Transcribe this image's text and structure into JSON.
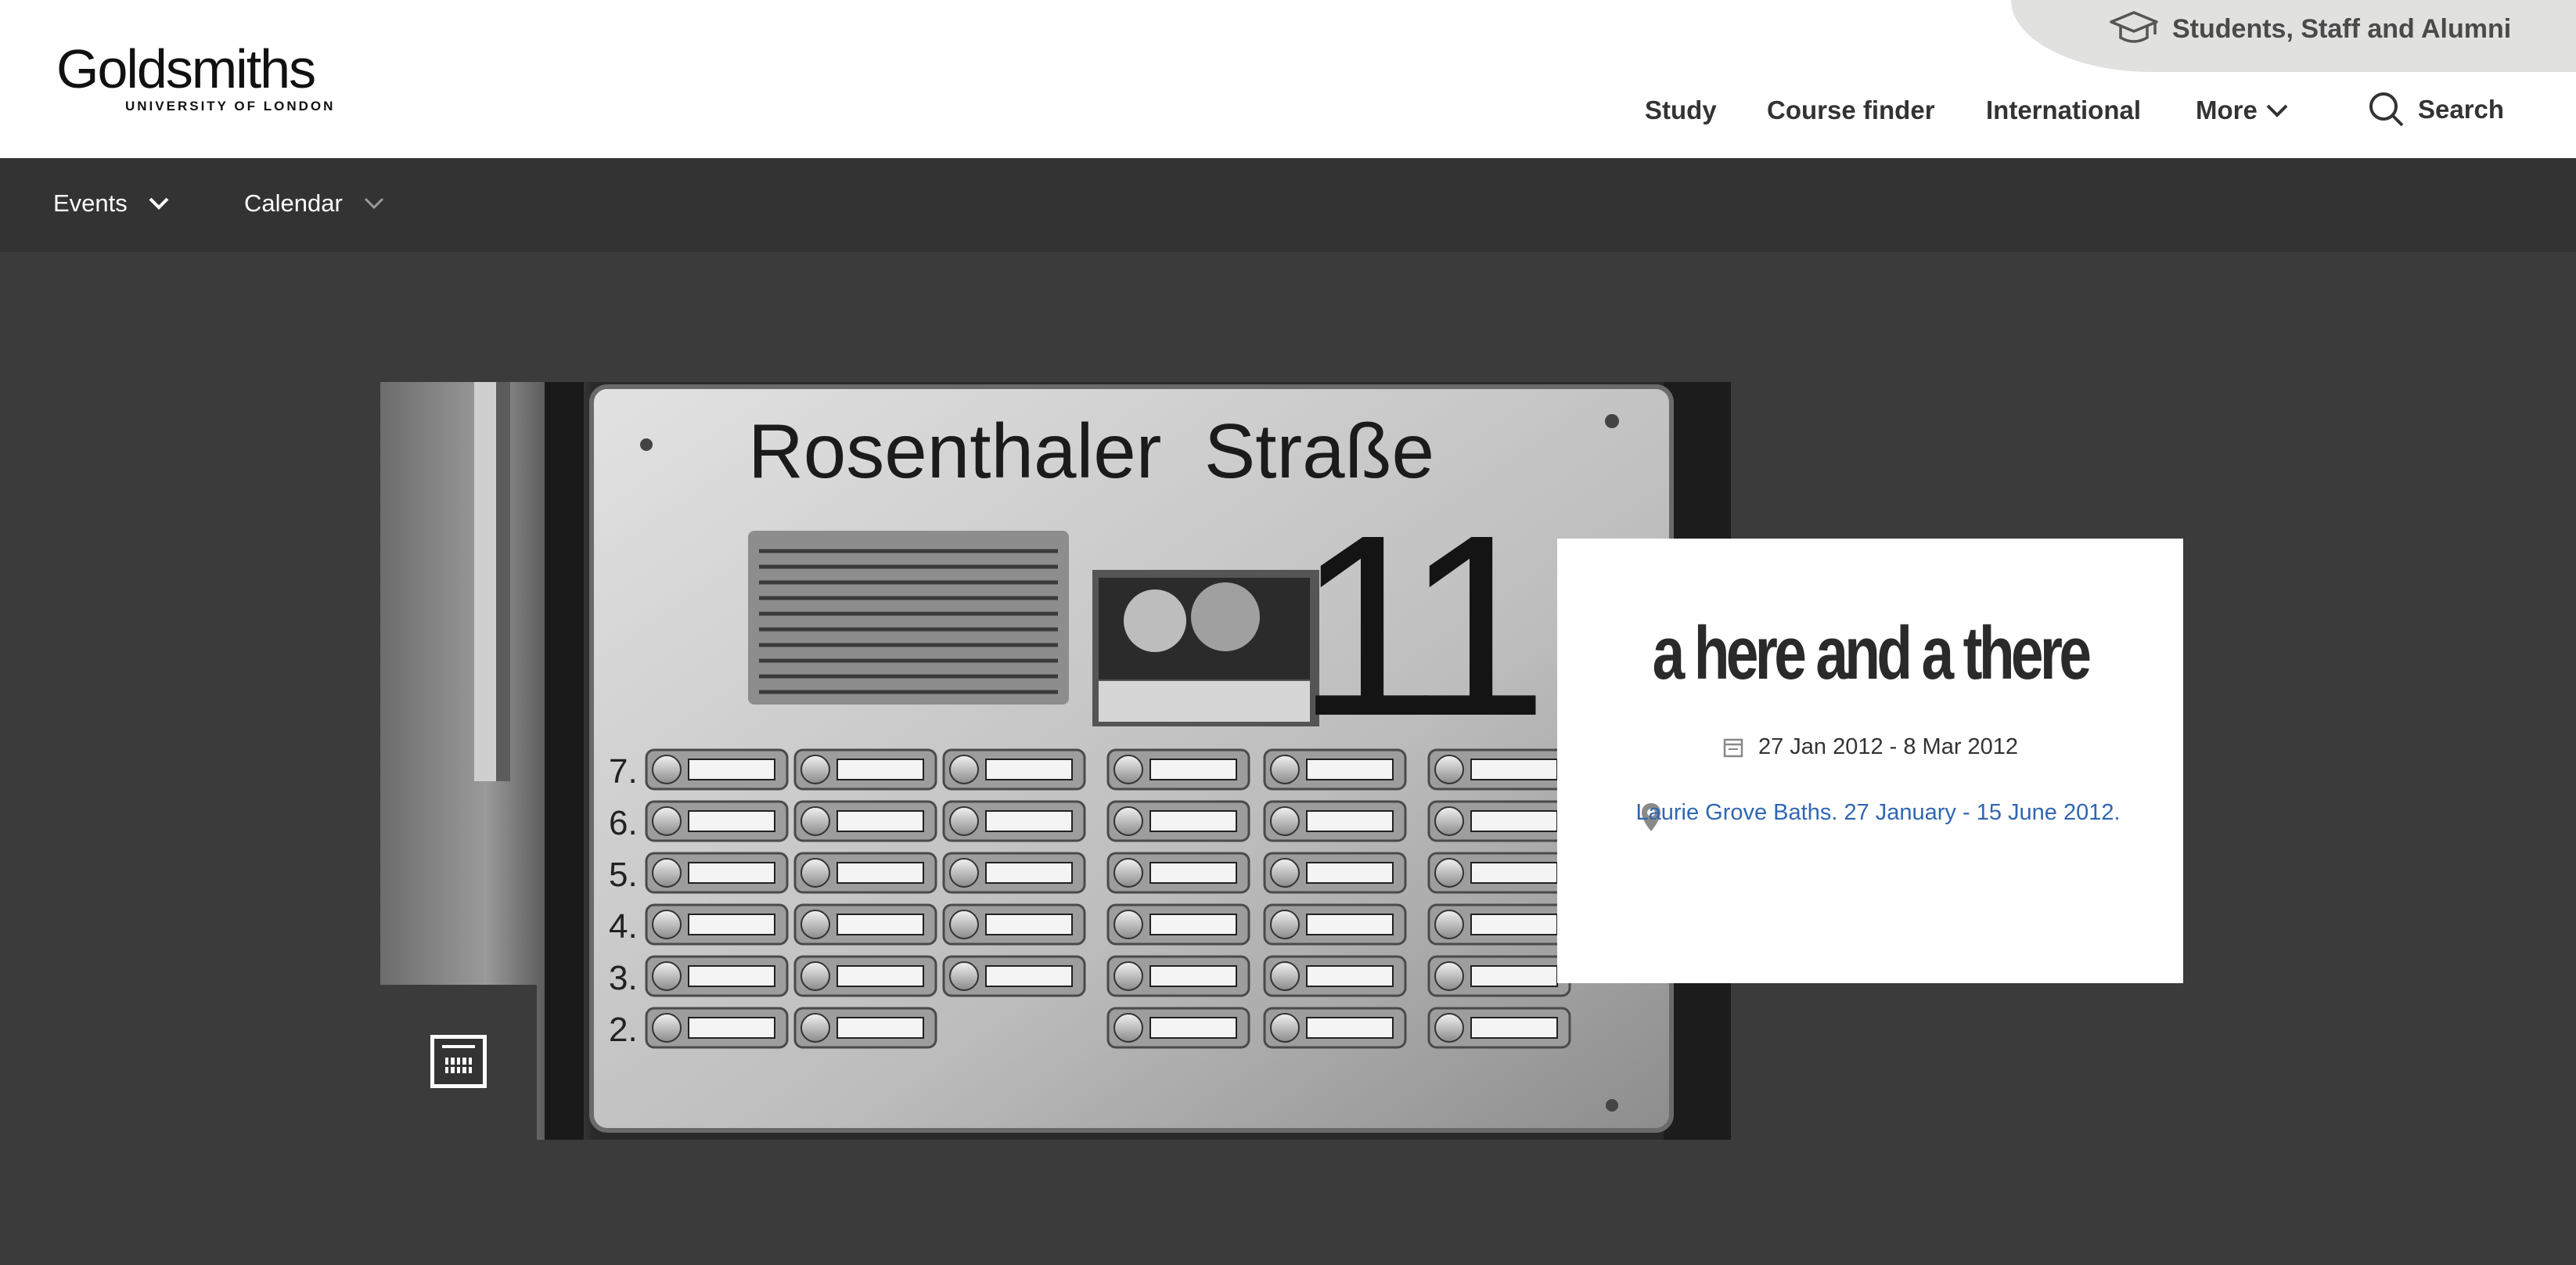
{
  "brand": {
    "name": "Goldsmiths",
    "subtitle": "UNIVERSITY OF LONDON"
  },
  "audience_link": {
    "label": "Students, Staff and Alumni",
    "icon": "graduation-cap-icon"
  },
  "main_nav": {
    "study": "Study",
    "course_finder": "Course finder",
    "international": "International",
    "more": "More",
    "search": "Search"
  },
  "sub_nav": {
    "events": "Events",
    "calendar": "Calendar"
  },
  "event": {
    "title": "a here and a there",
    "date_range": "27 Jan 2012 - 8 Mar 2012",
    "location": "Laurie Grove Baths. 27 January - 15 June 2012.",
    "date_icon": "calendar-icon",
    "location_icon": "map-pin-icon"
  },
  "hero_image": {
    "sign_text": "Rosenthaler  Straße",
    "house_number": "11",
    "floor_numbers": [
      "7.",
      "6.",
      "5.",
      "4.",
      "3.",
      "2."
    ]
  },
  "colors": {
    "header_bg": "#ffffff",
    "subnav_bg": "#333333",
    "page_bg": "#3b3b3b",
    "audience_bg": "#e1e1df",
    "link_blue": "#2f67b2"
  }
}
